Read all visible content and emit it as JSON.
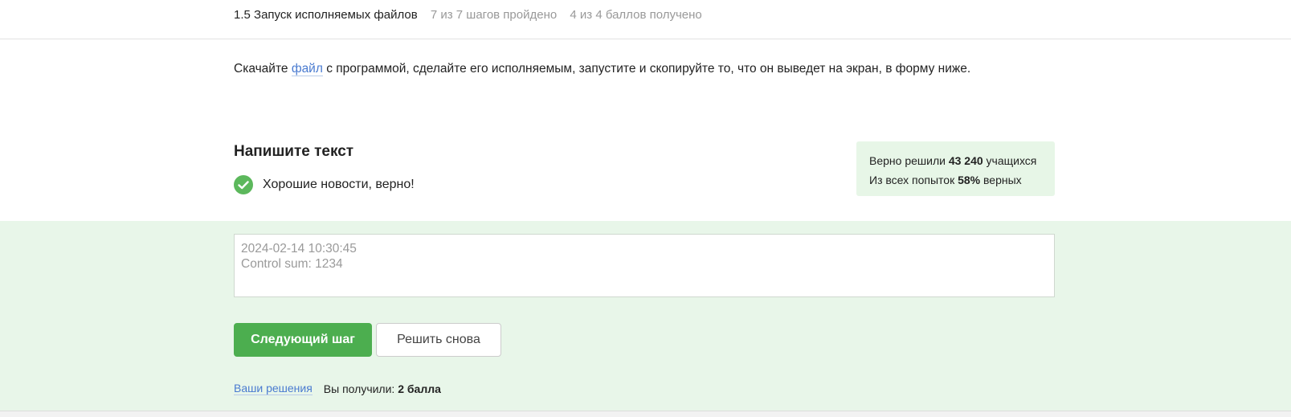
{
  "header": {
    "lesson_title": "1.5 Запуск исполняемых файлов",
    "steps_progress": "7 из 7 шагов пройдено",
    "points_progress": "4 из 4 баллов  получено"
  },
  "instruction": {
    "before_link": "Скачайте ",
    "link_text": "файл",
    "after_link": " с программой, сделайте его исполняемым, запустите и скопируйте то, что он выведет на экран, в форму ниже."
  },
  "task": {
    "title": "Напишите текст",
    "feedback": "Хорошие новости, верно!"
  },
  "stats": {
    "line1_prefix": "Верно решили ",
    "line1_value": "43 240",
    "line1_suffix": " учащихся",
    "line2_prefix": "Из всех попыток ",
    "line2_value": "58%",
    "line2_suffix": " верных"
  },
  "answer": {
    "line1": "2024-02-14 10:30:45",
    "line2": "Control sum: 1234"
  },
  "buttons": {
    "next_label": "Следующий шаг",
    "retry_label": "Решить снова"
  },
  "footer": {
    "solutions_link": "Ваши решения",
    "score_prefix": "Вы получили: ",
    "score_value": "2 балла"
  },
  "colors": {
    "accent_green": "#4cae4f",
    "link_blue": "#4a7bd0",
    "success_bg": "#e8f6e9"
  },
  "icons": {
    "feedback_icon": "check-circle-icon"
  }
}
